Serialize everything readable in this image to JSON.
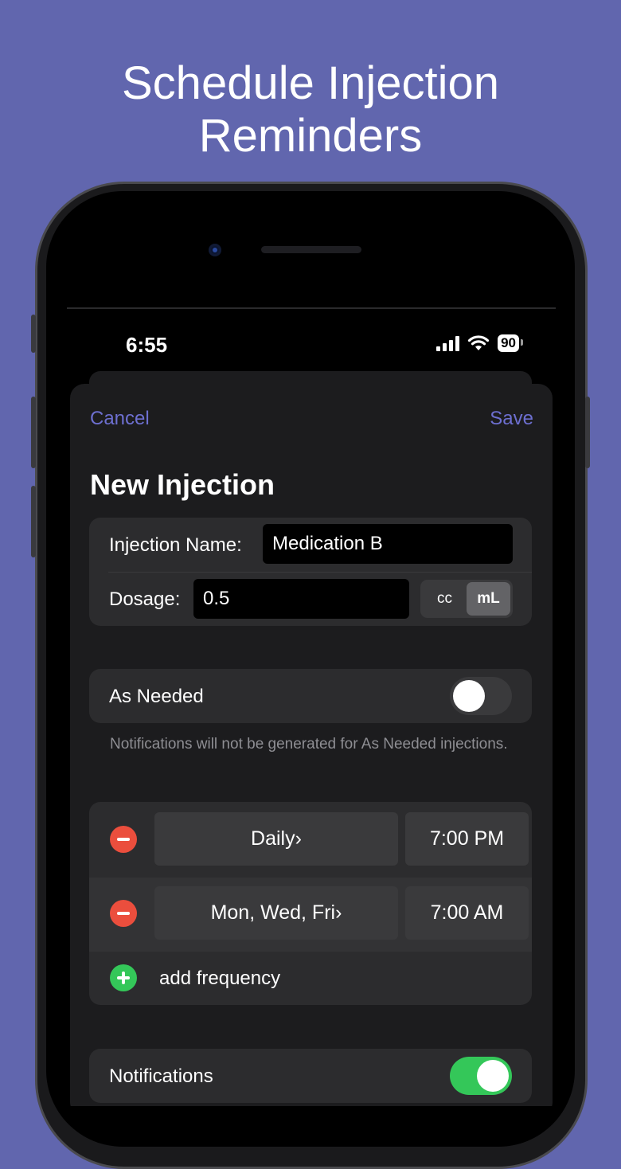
{
  "headline": [
    "Schedule Injection",
    "Reminders"
  ],
  "status_bar": {
    "time": "6:55",
    "battery": "90"
  },
  "nav": {
    "cancel_label": "Cancel",
    "save_label": "Save"
  },
  "sheet_title": "New Injection",
  "form": {
    "name_label": "Injection Name:",
    "name_value": "Medication B",
    "dosage_label": "Dosage:",
    "dosage_value": "0.5",
    "units": [
      "cc",
      "mL"
    ],
    "selected_unit": "mL"
  },
  "as_needed": {
    "label": "As Needed",
    "on": false,
    "footnote": "Notifications will not be generated for As Needed injections."
  },
  "frequencies": [
    {
      "days": "Daily",
      "time": "7:00 PM"
    },
    {
      "days": "Mon, Wed, Fri",
      "time": "7:00 AM"
    }
  ],
  "add_frequency_label": "add frequency",
  "notifications": {
    "label": "Notifications",
    "on": true
  },
  "colors": {
    "background": "#6166ae",
    "accent": "#6d6fd0",
    "toggle_on": "#34c759",
    "delete": "#eb4e3d"
  }
}
